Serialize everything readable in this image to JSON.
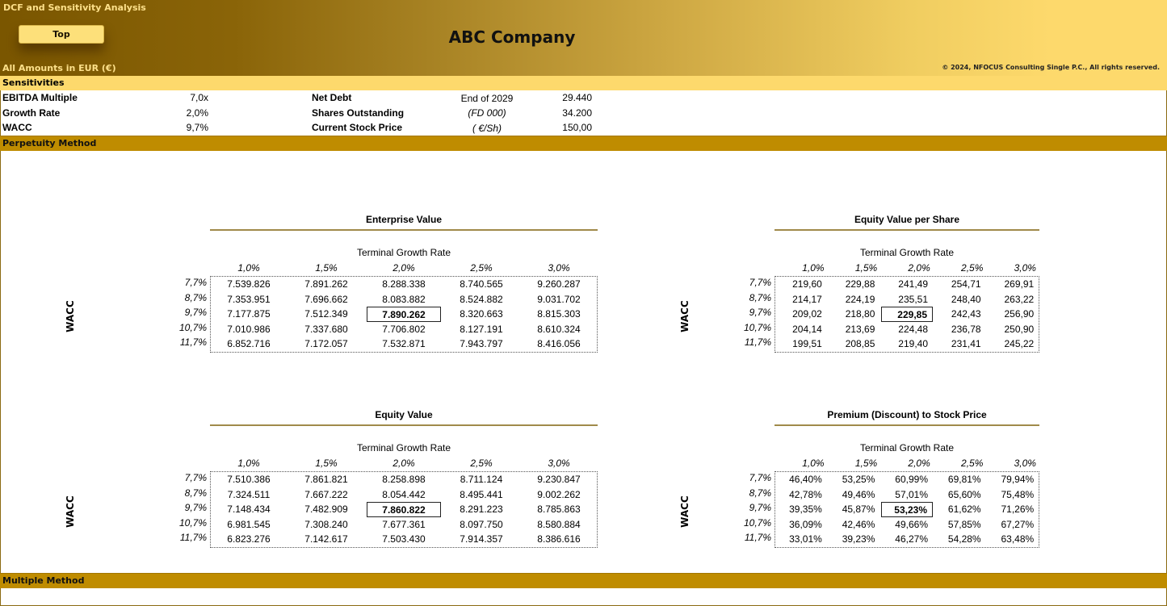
{
  "header": {
    "sheet_title": "DCF and Sensitivity Analysis",
    "top_button_label": "Top",
    "company_name": "ABC Company",
    "amounts_note": "All Amounts in  EUR (€)",
    "copyright": "© 2024, NFOCUS Consulting Single P.C., All rights reserved."
  },
  "sensitivities": {
    "section_label": "Sensitivities",
    "left": [
      {
        "label": "EBITDA Multiple",
        "value": "7,0x"
      },
      {
        "label": "Growth Rate",
        "value": "2,0%"
      },
      {
        "label": "WACC",
        "value": "9,7%"
      }
    ],
    "right": [
      {
        "label": "Net Debt",
        "unit": "End of 2029",
        "value": "29.440"
      },
      {
        "label": "Shares Outstanding",
        "unit": "(FD 000)",
        "value": "34.200"
      },
      {
        "label": "Current Stock Price",
        "unit": "( €/Sh)",
        "value": "150,00"
      }
    ]
  },
  "sections": {
    "perpetuity": "Perpetuity Method",
    "multiple": "Multiple Method"
  },
  "colors": {
    "section_bar": "#bf8c00",
    "sensitivities_bar": "#fdd96c",
    "banner_dark": "#7a5600",
    "banner_light": "#fdd96c"
  },
  "tables": [
    {
      "title": "Enterprise Value",
      "col_axis": "Terminal Growth Rate",
      "row_axis": "WACC",
      "cols": [
        "1,0%",
        "1,5%",
        "2,0%",
        "2,5%",
        "3,0%"
      ],
      "rows": [
        "7,7%",
        "8,7%",
        "9,7%",
        "10,7%",
        "11,7%"
      ],
      "base": [
        2,
        2
      ],
      "values": [
        [
          "7.539.826",
          "7.891.262",
          "8.288.338",
          "8.740.565",
          "9.260.287"
        ],
        [
          "7.353.951",
          "7.696.662",
          "8.083.882",
          "8.524.882",
          "9.031.702"
        ],
        [
          "7.177.875",
          "7.512.349",
          "7.890.262",
          "8.320.663",
          "8.815.303"
        ],
        [
          "7.010.986",
          "7.337.680",
          "7.706.802",
          "8.127.191",
          "8.610.324"
        ],
        [
          "6.852.716",
          "7.172.057",
          "7.532.871",
          "7.943.797",
          "8.416.056"
        ]
      ]
    },
    {
      "title": "Equity Value per Share",
      "col_axis": "Terminal Growth Rate",
      "row_axis": "WACC",
      "cols": [
        "1,0%",
        "1,5%",
        "2,0%",
        "2,5%",
        "3,0%"
      ],
      "rows": [
        "7,7%",
        "8,7%",
        "9,7%",
        "10,7%",
        "11,7%"
      ],
      "base": [
        2,
        2
      ],
      "values": [
        [
          "219,60",
          "229,88",
          "241,49",
          "254,71",
          "269,91"
        ],
        [
          "214,17",
          "224,19",
          "235,51",
          "248,40",
          "263,22"
        ],
        [
          "209,02",
          "218,80",
          "229,85",
          "242,43",
          "256,90"
        ],
        [
          "204,14",
          "213,69",
          "224,48",
          "236,78",
          "250,90"
        ],
        [
          "199,51",
          "208,85",
          "219,40",
          "231,41",
          "245,22"
        ]
      ]
    },
    {
      "title": "Equity Value",
      "col_axis": "Terminal Growth Rate",
      "row_axis": "WACC",
      "cols": [
        "1,0%",
        "1,5%",
        "2,0%",
        "2,5%",
        "3,0%"
      ],
      "rows": [
        "7,7%",
        "8,7%",
        "9,7%",
        "10,7%",
        "11,7%"
      ],
      "base": [
        2,
        2
      ],
      "values": [
        [
          "7.510.386",
          "7.861.821",
          "8.258.898",
          "8.711.124",
          "9.230.847"
        ],
        [
          "7.324.511",
          "7.667.222",
          "8.054.442",
          "8.495.441",
          "9.002.262"
        ],
        [
          "7.148.434",
          "7.482.909",
          "7.860.822",
          "8.291.223",
          "8.785.863"
        ],
        [
          "6.981.545",
          "7.308.240",
          "7.677.361",
          "8.097.750",
          "8.580.884"
        ],
        [
          "6.823.276",
          "7.142.617",
          "7.503.430",
          "7.914.357",
          "8.386.616"
        ]
      ]
    },
    {
      "title": "Premium (Discount) to Stock Price",
      "col_axis": "Terminal Growth Rate",
      "row_axis": "WACC",
      "cols": [
        "1,0%",
        "1,5%",
        "2,0%",
        "2,5%",
        "3,0%"
      ],
      "rows": [
        "7,7%",
        "8,7%",
        "9,7%",
        "10,7%",
        "11,7%"
      ],
      "base": [
        2,
        2
      ],
      "values": [
        [
          "46,40%",
          "53,25%",
          "60,99%",
          "69,81%",
          "79,94%"
        ],
        [
          "42,78%",
          "49,46%",
          "57,01%",
          "65,60%",
          "75,48%"
        ],
        [
          "39,35%",
          "45,87%",
          "53,23%",
          "61,62%",
          "71,26%"
        ],
        [
          "36,09%",
          "42,46%",
          "49,66%",
          "57,85%",
          "67,27%"
        ],
        [
          "33,01%",
          "39,23%",
          "46,27%",
          "54,28%",
          "63,48%"
        ]
      ]
    }
  ]
}
